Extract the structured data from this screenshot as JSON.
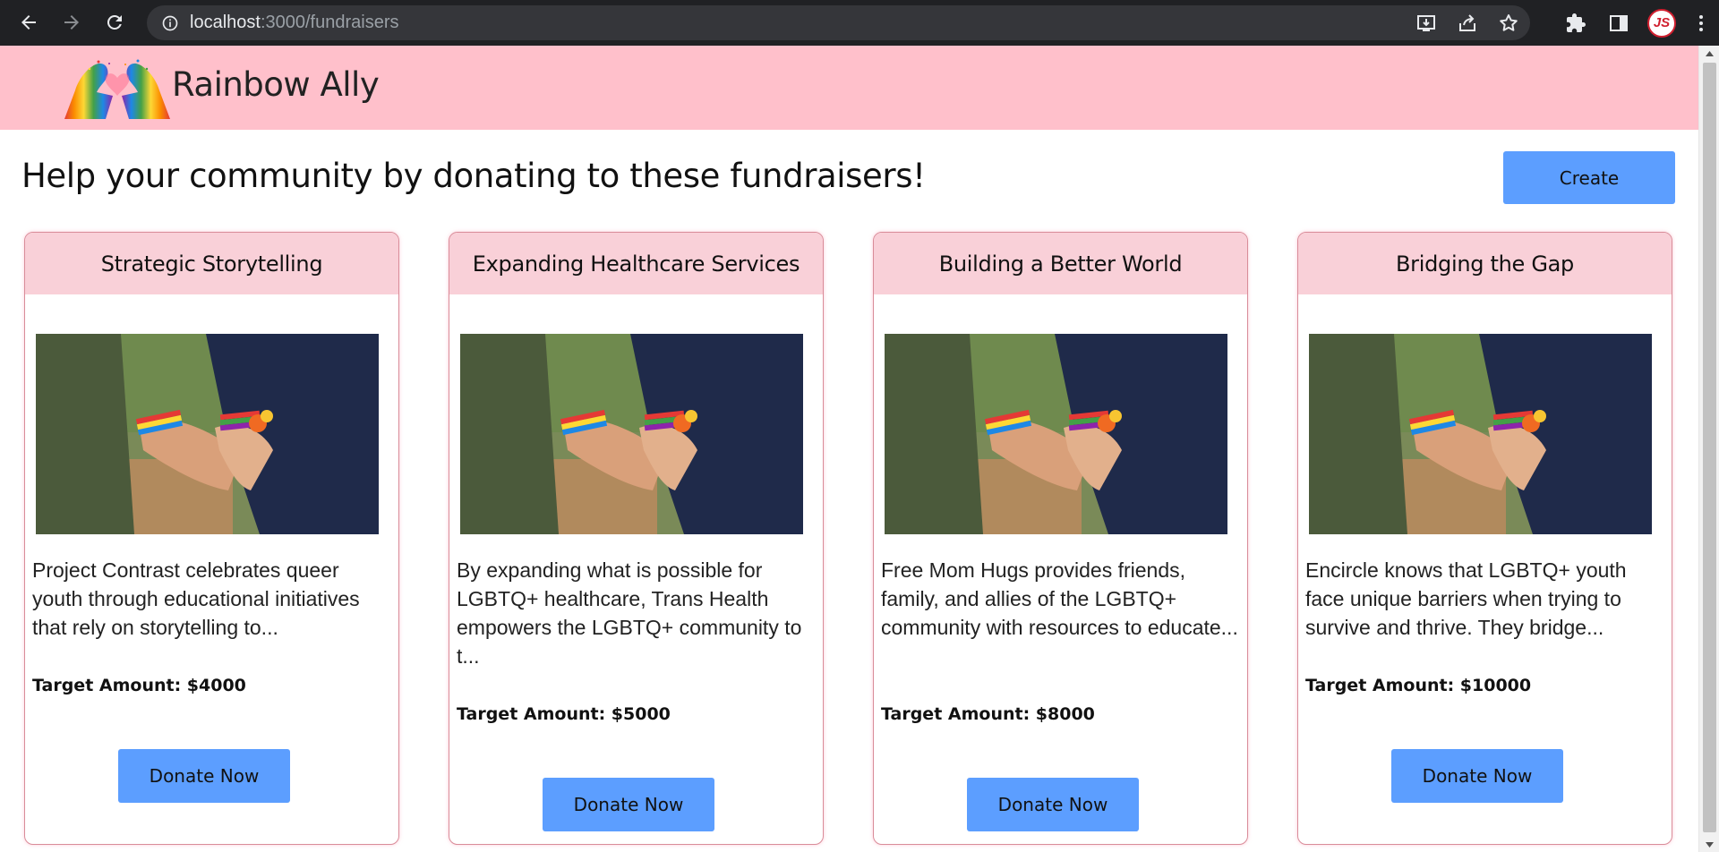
{
  "browser": {
    "url_host": "localhost",
    "url_path": ":3000/fundraisers",
    "avatar_text": "JS"
  },
  "site": {
    "brand": "Rainbow Ally",
    "headline": "Help your community by donating to these fundraisers!",
    "create_label": "Create"
  },
  "cards": [
    {
      "title": "Strategic Storytelling",
      "description": "Project Contrast celebrates queer youth through educational initiatives that rely on storytelling to...",
      "target": "Target Amount: $4000",
      "donate_label": "Donate Now"
    },
    {
      "title": "Expanding Healthcare Services",
      "description": "By expanding what is possible for LGBTQ+ healthcare, Trans Health empowers the LGBTQ+ community to t...",
      "target": "Target Amount: $5000",
      "donate_label": "Donate Now"
    },
    {
      "title": "Building a Better World",
      "description": "Free Mom Hugs provides friends, family, and allies of the LGBTQ+ community with resources to educate...",
      "target": "Target Amount: $8000",
      "donate_label": "Donate Now"
    },
    {
      "title": "Bridging the Gap",
      "description": "Encircle knows that LGBTQ+ youth face unique barriers when trying to survive and thrive. They bridge...",
      "target": "Target Amount: $10000",
      "donate_label": "Donate Now"
    }
  ],
  "colors": {
    "header_bg": "#ffc0cb",
    "card_head_bg": "#f9d0d8",
    "button_bg": "#5c9eff"
  }
}
